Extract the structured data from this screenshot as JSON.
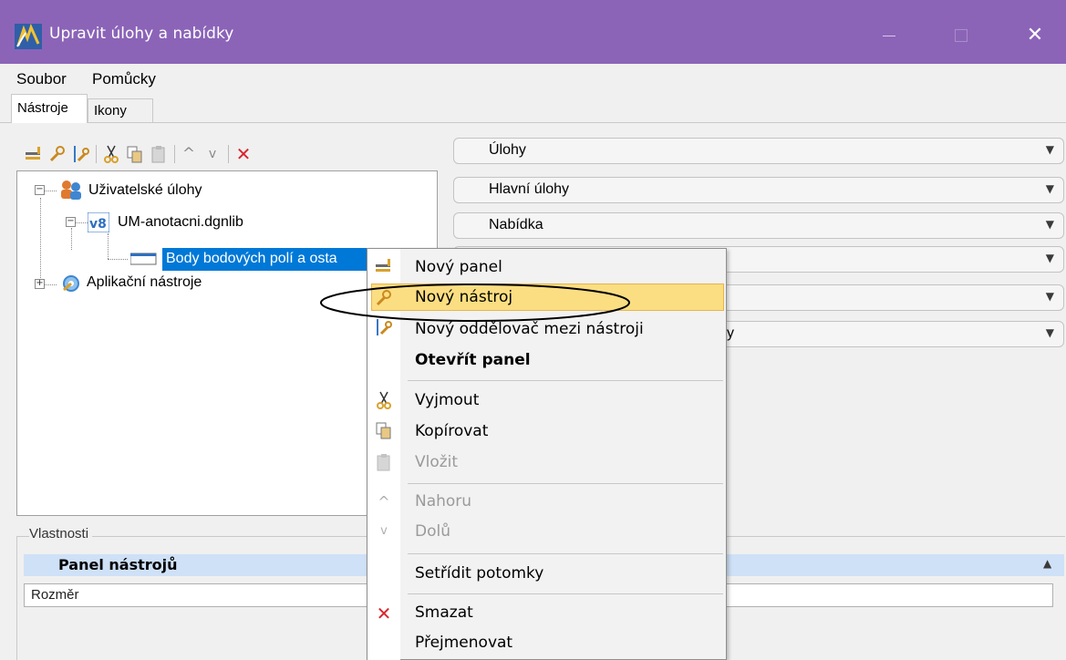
{
  "window": {
    "title": "Upravit úlohy a nabídky",
    "close_glyph": "✕"
  },
  "menubar": {
    "items": [
      "Soubor",
      "Pomůcky"
    ]
  },
  "tabs": [
    "Nástroje",
    "Ikony"
  ],
  "toolbar": {
    "icons": [
      "new-panel-icon",
      "new-tool-icon",
      "new-separator-icon",
      "cut-icon",
      "copy-icon",
      "paste-icon",
      "move-up-icon",
      "move-down-icon",
      "delete-icon"
    ],
    "up_glyph": "^",
    "down_glyph": "v",
    "delete_glyph": "✕"
  },
  "tree": {
    "root_label": "Uživatelské úlohy",
    "lib_label": "UM-anotacni.dgnlib",
    "selected_label": "Body bodových polí a ostatní ...",
    "selected_visible": "Body bodových polí a osta",
    "app_label": "Aplikační nástroje",
    "minus": "−",
    "plus": "+"
  },
  "dropdowns": [
    {
      "label": "Úlohy"
    },
    {
      "label": "Hlavní úlohy"
    },
    {
      "label": "Nabídka"
    },
    {
      "label": ""
    },
    {
      "label": ""
    },
    {
      "label": ""
    }
  ],
  "dropdown_fragment": "y",
  "dropdown_arrow": "▼",
  "properties": {
    "section_label": "Vlastnosti",
    "header": "Panel nástrojů",
    "header_arrow": "▲",
    "row_label": "Rozměr"
  },
  "context_menu": {
    "items": [
      {
        "label": "Nový panel",
        "icon": "new-panel-icon"
      },
      {
        "label": "Nový nástroj",
        "icon": "new-tool-icon",
        "highlighted": true
      },
      {
        "label": "Nový oddělovač mezi nástroji",
        "icon": "new-separator-icon"
      },
      {
        "label": "Otevřít panel",
        "bold": true
      },
      {
        "label": "Vyjmout",
        "icon": "cut-icon"
      },
      {
        "label": "Kopírovat",
        "icon": "copy-icon"
      },
      {
        "label": "Vložit",
        "icon": "paste-icon",
        "disabled": true
      },
      {
        "label": "Nahoru",
        "icon": "move-up-icon",
        "disabled": true
      },
      {
        "label": "Dolů",
        "icon": "move-down-icon",
        "disabled": true
      },
      {
        "label": "Setřídit potomky"
      },
      {
        "label": "Smazat",
        "icon": "delete-icon"
      },
      {
        "label": "Přejmenovat"
      }
    ],
    "icon_glyphs": {
      "cut": "✂",
      "up": "^",
      "down": "v",
      "delete": "✕"
    }
  },
  "colors": {
    "titlebar": "#8b64b8",
    "selection": "#0078d7",
    "highlight": "#fbde82",
    "prop_header": "#cfe1f7",
    "delete_red": "#d9262e"
  }
}
